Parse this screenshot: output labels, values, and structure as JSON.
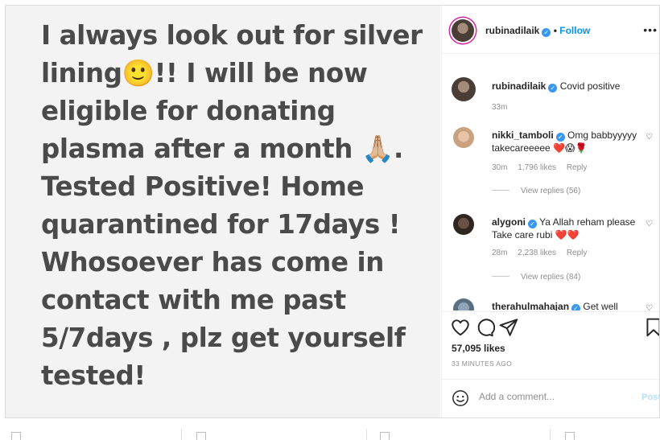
{
  "post": {
    "image_text_lines": [
      "I always look out for silver",
      "lining🙂!! I will be now",
      "eligible for donating",
      "plasma after a month 🙏🏼.",
      "Tested Positive! Home",
      "quarantined for 17days !",
      "Whosoever has come in",
      "contact with me past",
      "5/7days , plz get yourself",
      "tested!"
    ]
  },
  "header": {
    "username": "rubinadilaik",
    "separator": "•",
    "follow_label": "Follow",
    "more_label": "•••"
  },
  "caption": {
    "username": "rubinadilaik",
    "text": "Covid positive",
    "time": "33m"
  },
  "comments": [
    {
      "username": "nikki_tamboli",
      "text": "Omg babbyyyyy takecareeeee ❤️😱🌹",
      "time": "30m",
      "likes": "1,796 likes",
      "reply_label": "Reply",
      "view_replies": "View replies (56)"
    },
    {
      "username": "alygoni",
      "text": "Ya Allah reham please Take care rubi ❤️❤️",
      "time": "28m",
      "likes": "2,238 likes",
      "reply_label": "Reply",
      "view_replies": "View replies (84)"
    },
    {
      "username": "therahulmahajan",
      "text": "Get well"
    }
  ],
  "actions": {
    "likes_count": "57,095 likes",
    "time_ago": "33 MINUTES AGO"
  },
  "add_comment": {
    "placeholder": "Add a comment...",
    "post_label": "Post"
  },
  "colors": {
    "link_blue": "#0095f6",
    "heart_red": "#ed4956",
    "verified_blue": "#3897f0",
    "post_bg": "#f3f3f3",
    "post_text": "#4a4a4a"
  },
  "icons": {
    "like": "heart-icon",
    "comment": "comment-icon",
    "share": "share-icon",
    "save": "bookmark-icon",
    "emoji": "smile-icon",
    "comment_like": "heart-small-icon"
  }
}
